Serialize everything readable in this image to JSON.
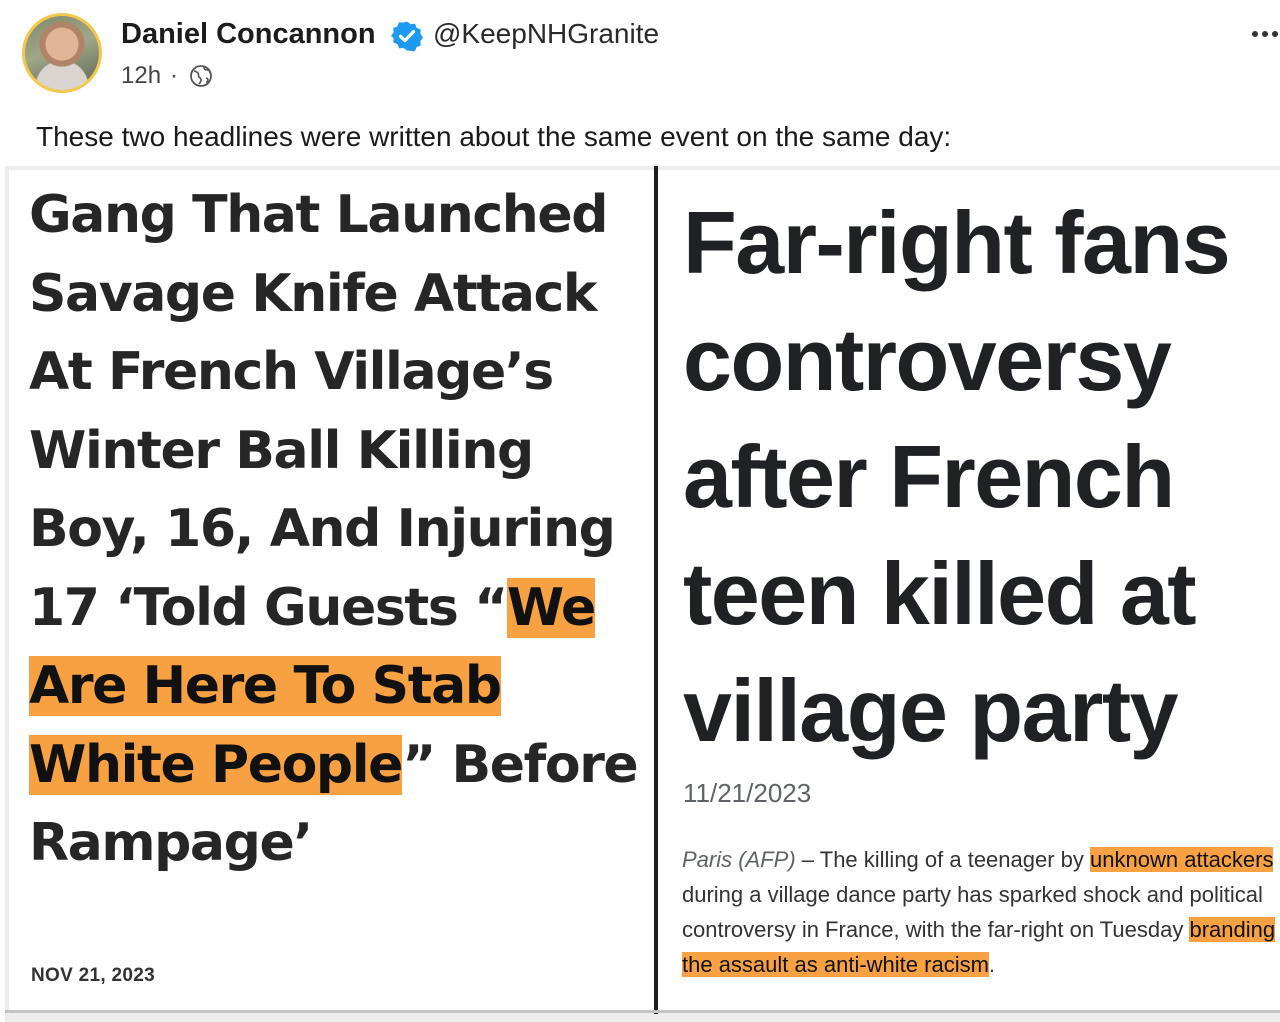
{
  "author": {
    "name": "Daniel Concannon",
    "handle": "@KeepNHGranite",
    "time": "12h",
    "separator": "·",
    "verified_icon": "verified-badge-icon",
    "visibility_icon": "globe-icon"
  },
  "post": {
    "caption": "These two headlines were written about the same event on the same day:",
    "more_icon": "more-options-icon"
  },
  "left_article": {
    "headline_pre": "Gang That Launched Savage Knife Attack At French Village’s Winter Ball Killing Boy, 16, And Injuring 17 ‘Told Guests “",
    "headline_highlight_1": "We",
    "headline_space": " ",
    "headline_highlight_2": "Are Here To Stab White People",
    "headline_post": "” Before Rampage’",
    "date": "NOV 21, 2023"
  },
  "right_article": {
    "headline": "Far-right fans controversy after French teen killed at village party",
    "date": "11/21/2023",
    "dateline": "Paris (AFP)",
    "body_1": " – The killing of a teenager by ",
    "body_highlight_1": "unknown attackers",
    "body_2": " during a village dance party has sparked shock and political controversy in France, with the far-right on Tuesday ",
    "body_highlight_2": "branding the assault as anti-white racism",
    "body_3": "."
  },
  "colors": {
    "highlight": "#f8a142",
    "avatar_ring": "#f2c94c",
    "verified": "#1d9bf0"
  }
}
